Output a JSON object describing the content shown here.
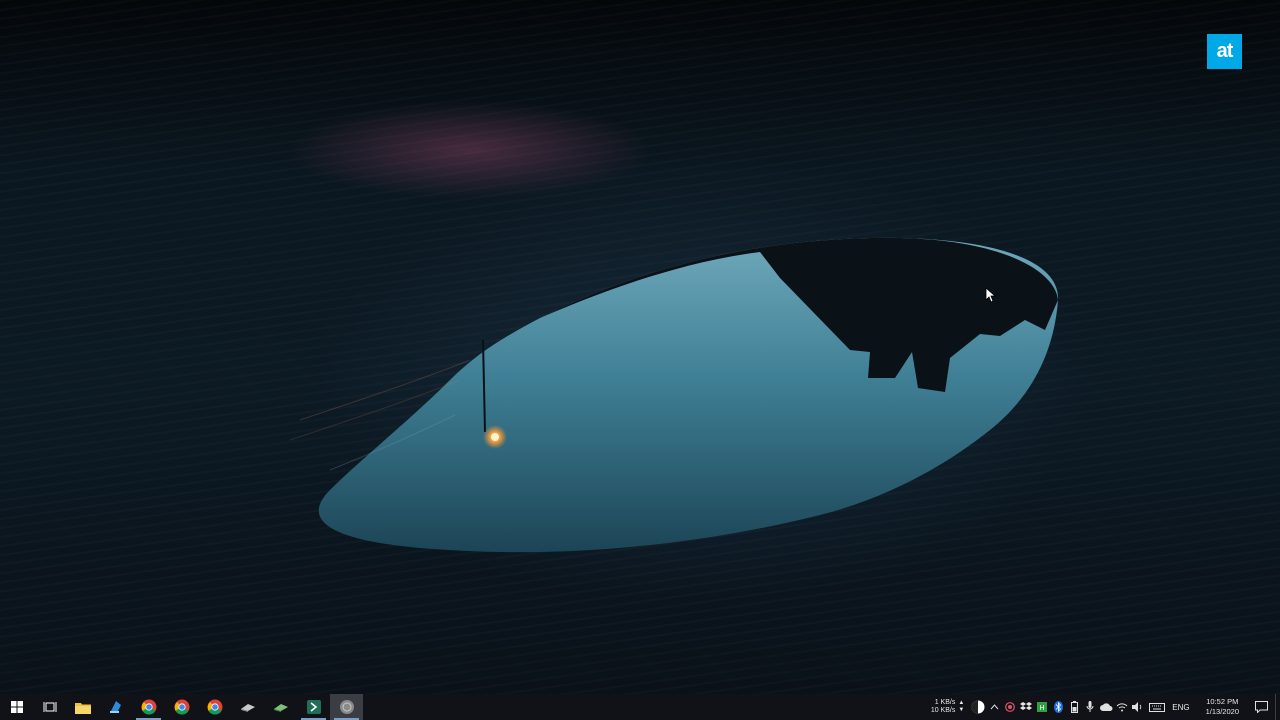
{
  "desktop": {
    "logo_text": "at"
  },
  "taskbar": {
    "apps": [
      {
        "icon": "windows-start-icon",
        "color": "#ffffff"
      },
      {
        "icon": "task-view-icon",
        "color": "#ffffff"
      },
      {
        "icon": "file-explorer-icon",
        "color": "#f0c040"
      },
      {
        "icon": "app-blue-icon",
        "color": "#2e8bd8"
      },
      {
        "icon": "chrome-icon",
        "color": "#db4437"
      },
      {
        "icon": "chrome-icon-2",
        "color": "#db4437"
      },
      {
        "icon": "chrome-icon-3",
        "color": "#db4437"
      },
      {
        "icon": "app-gray-icon",
        "color": "#c8c8c8"
      },
      {
        "icon": "app-green-icon",
        "color": "#7ec07a"
      },
      {
        "icon": "terminal-icon",
        "color": "#2aa078"
      },
      {
        "icon": "app-circle-icon",
        "color": "#9a9a9a"
      }
    ],
    "tray": {
      "upload_speed": "1 KB/s",
      "download_speed": "10 KB/s",
      "language": "ENG",
      "time": "10:52 PM",
      "date": "1/13/2020"
    }
  }
}
